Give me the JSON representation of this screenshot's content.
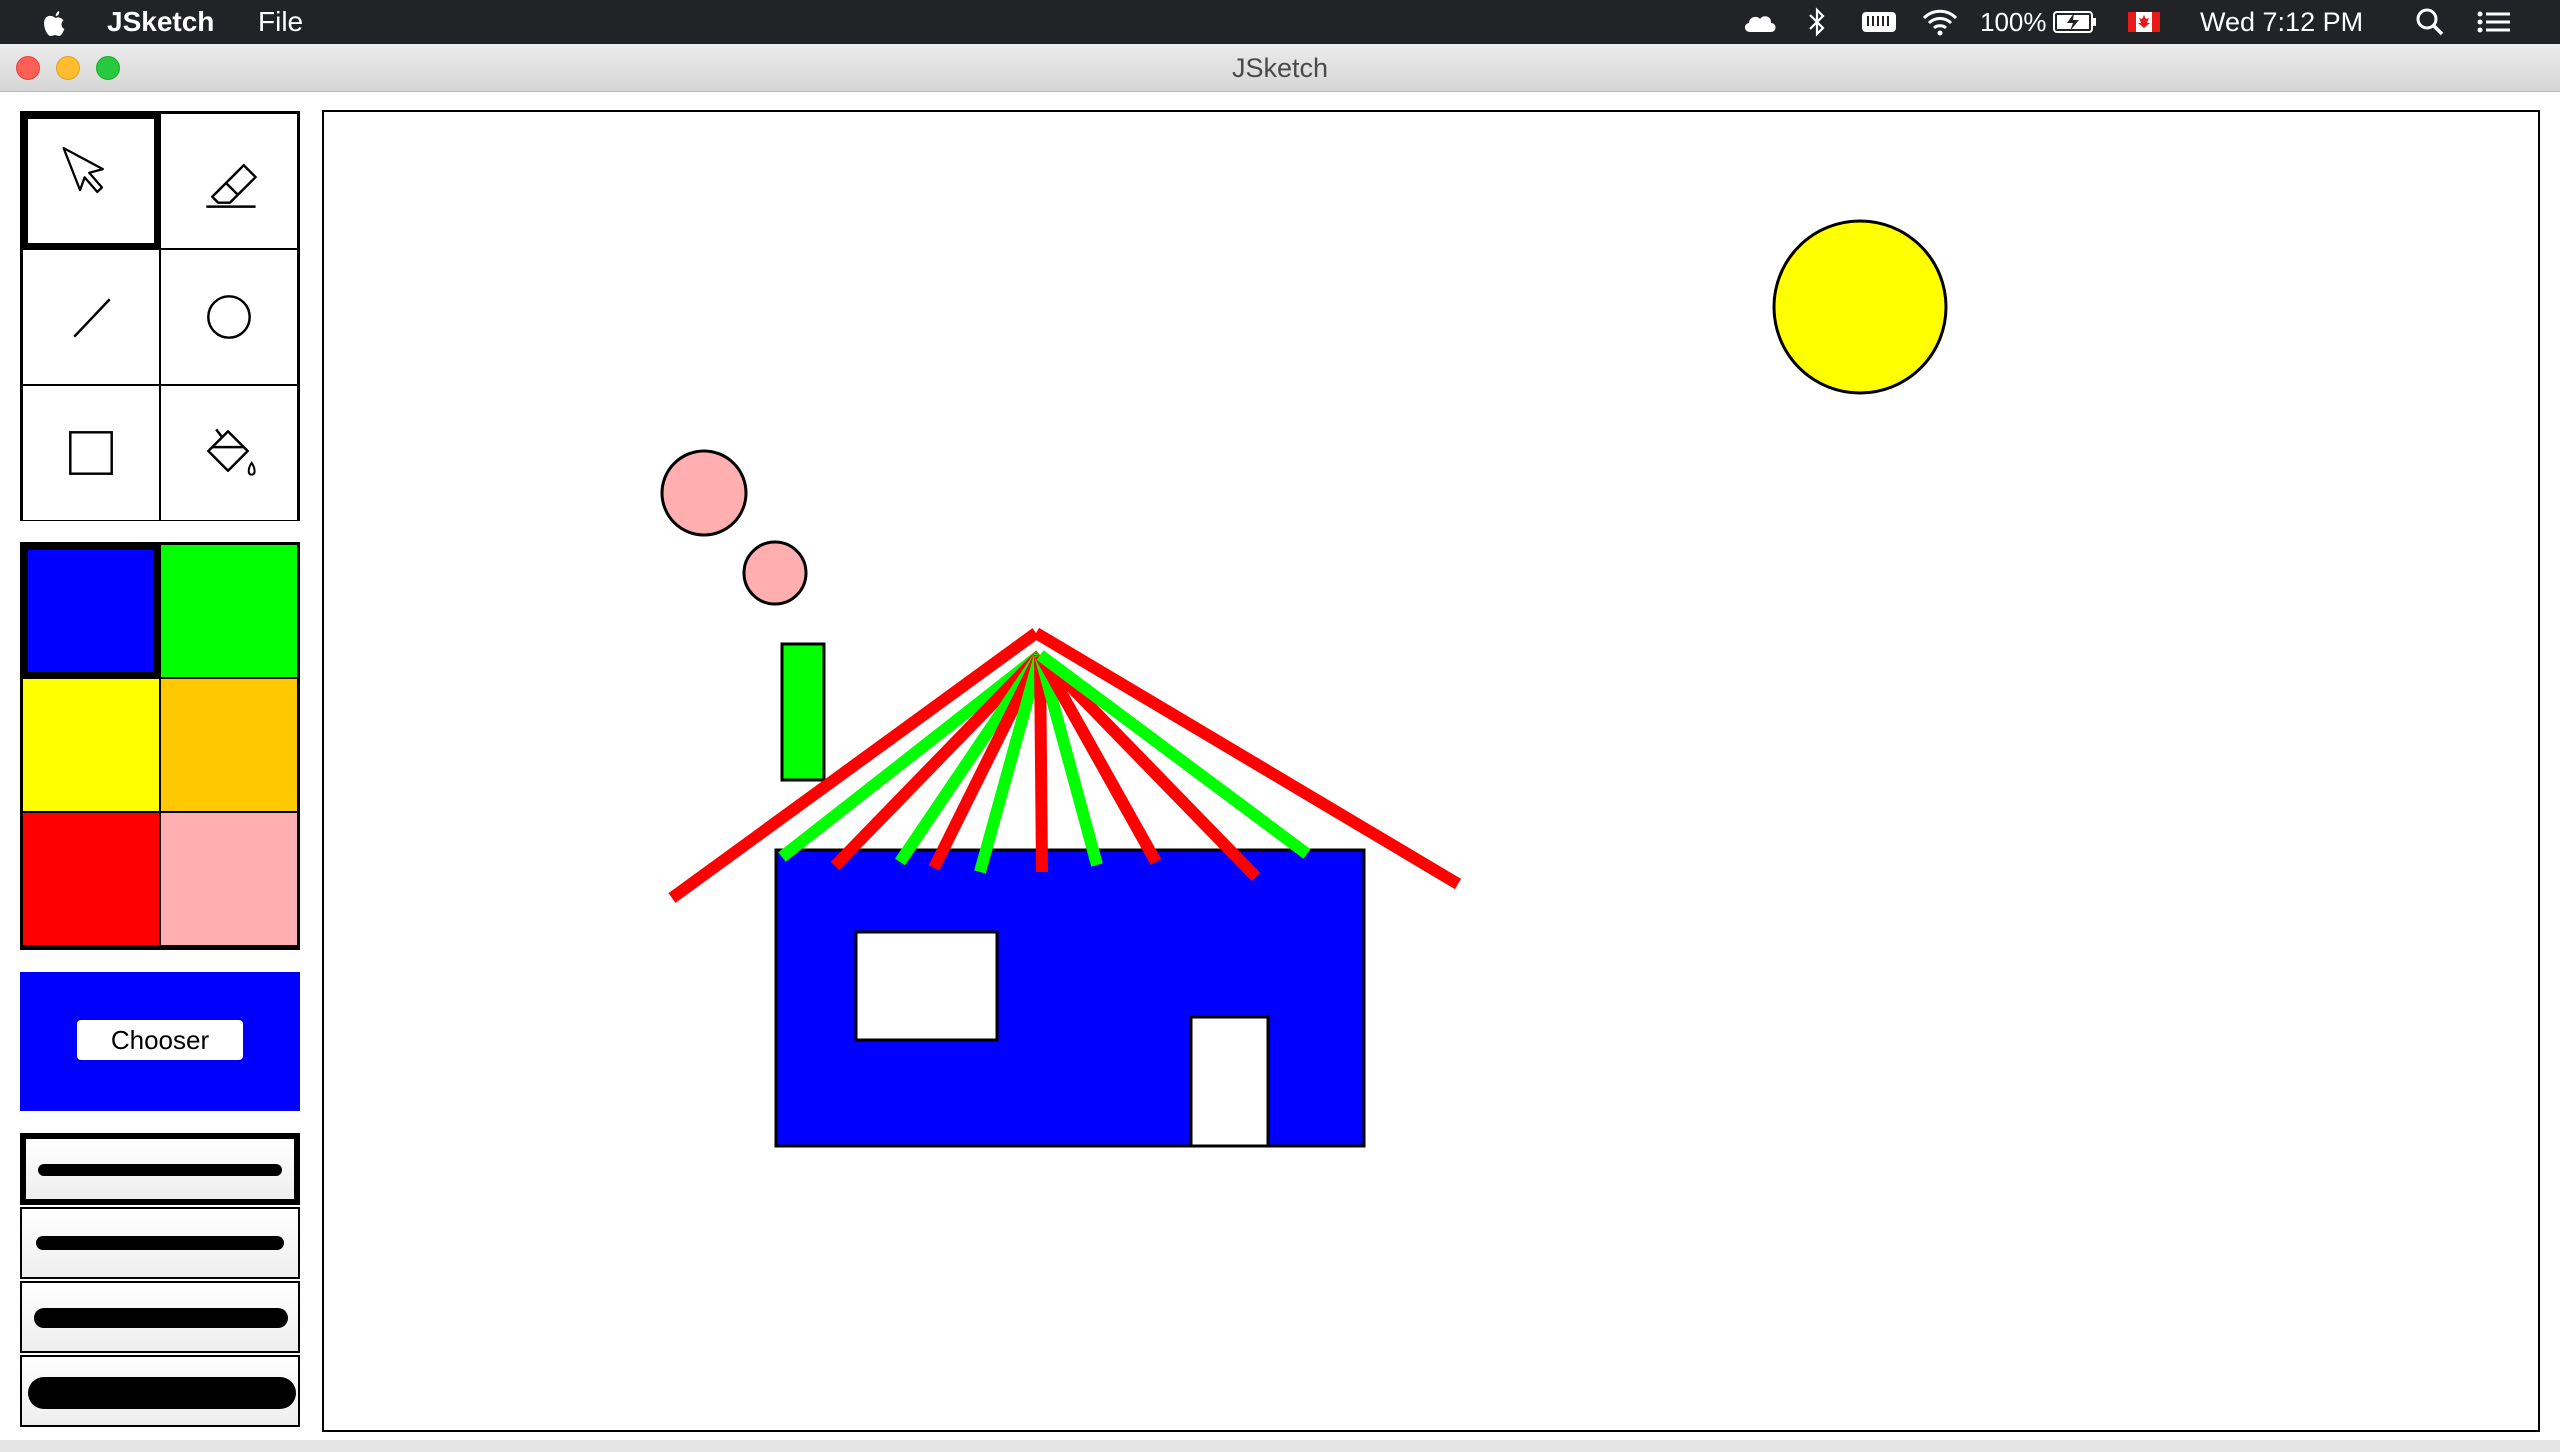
{
  "menubar": {
    "app_name": "JSketch",
    "menus": [
      "File"
    ],
    "battery": "100%",
    "clock": "Wed 7:12 PM",
    "status_icons": [
      "apple-icon",
      "icloud-icon",
      "bluetooth-icon",
      "keyboard-icon",
      "wifi-icon",
      "battery-charging-icon",
      "canada-flag-icon",
      "search-icon",
      "list-icon"
    ]
  },
  "window": {
    "title": "JSketch",
    "traffic_lights": [
      "close",
      "minimize",
      "zoom"
    ]
  },
  "tools": [
    {
      "name": "select",
      "icon": "cursor-icon",
      "selected": true
    },
    {
      "name": "erase",
      "icon": "eraser-icon",
      "selected": false
    },
    {
      "name": "line",
      "icon": "line-icon",
      "selected": false
    },
    {
      "name": "circle",
      "icon": "circle-icon",
      "selected": false
    },
    {
      "name": "rectangle",
      "icon": "rectangle-icon",
      "selected": false
    },
    {
      "name": "fill",
      "icon": "paint-bucket-icon",
      "selected": false
    }
  ],
  "colors": {
    "palette": [
      "#0000ff",
      "#00ff00",
      "#ffff00",
      "#ffc800",
      "#ff0000",
      "#ffafaf"
    ],
    "selected": "#0000ff"
  },
  "chooser": {
    "label": "Chooser",
    "current_color": "#0000ff"
  },
  "strokes": {
    "options": [
      1,
      2,
      3,
      4
    ],
    "selected": 1
  },
  "drawing": {
    "colors": {
      "house": "#0000ff",
      "window": "#ffffff",
      "door": "#ffffff",
      "chimney": "#00ff00",
      "smoke": "#ffafaf",
      "sun": "#ffff00",
      "roof_red": "#ff0000",
      "roof_green": "#00ff00"
    }
  }
}
